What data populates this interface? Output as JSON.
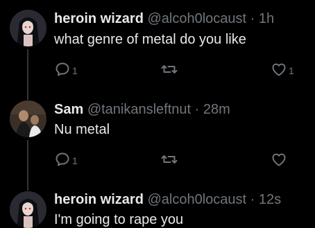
{
  "tweets": [
    {
      "name": "heroin wizard",
      "handle": "@alcoh0locaust",
      "dot": "·",
      "time": "1h",
      "text": "what genre of metal do you like",
      "reply_count": "1",
      "retweet_count": "",
      "like_count": "1"
    },
    {
      "name": "Sam",
      "handle": "@tanikansleftnut",
      "dot": "·",
      "time": "28m",
      "text": "Nu metal",
      "reply_count": "1",
      "retweet_count": "",
      "like_count": ""
    },
    {
      "name": "heroin wizard",
      "handle": "@alcoh0locaust",
      "dot": "·",
      "time": "12s",
      "text": "I'm going to rape you",
      "reply_count": "",
      "retweet_count": "",
      "like_count": ""
    }
  ],
  "icons": {
    "reply": "reply-icon",
    "retweet": "retweet-icon",
    "like": "heart-icon"
  },
  "colors": {
    "background": "#000000",
    "text": "#e7e9ea",
    "secondary": "#71767b",
    "thread_line": "#333639"
  }
}
